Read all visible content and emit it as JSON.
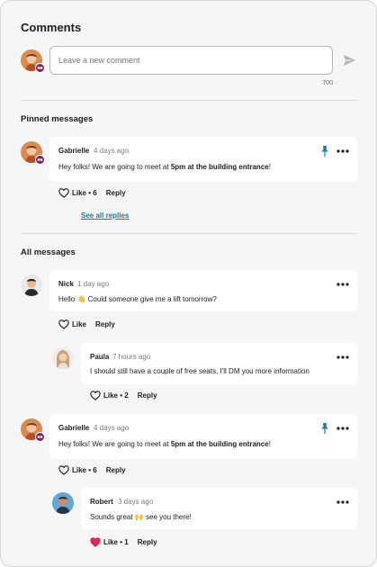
{
  "header": {
    "title": "Comments"
  },
  "composer": {
    "placeholder": "Leave a new comment",
    "counter": "700"
  },
  "sections": {
    "pinned": "Pinned messages",
    "all": "All messages"
  },
  "pinned_message": {
    "author": "Gabrielle",
    "time": "4 days ago",
    "text_before": "Hey folks! We are going to meet at ",
    "text_bold": "5pm at the building entrance",
    "text_after": "!",
    "like_label": "Like",
    "like_count": "• 6",
    "reply_label": "Reply",
    "see_replies": "See all replies"
  },
  "messages": [
    {
      "author": "Nick",
      "time": "1 day ago",
      "text_before": "Hello ",
      "emoji": "👋",
      "text_after": " Could someone give me a lift tomorrow?",
      "like_label": "Like",
      "reply_label": "Reply"
    },
    {
      "author": "Paula",
      "time": "7 hours ago",
      "text": "I should still have a couple of free seats, I'll DM you more information",
      "like_label": "Like",
      "like_count": "• 2",
      "reply_label": "Reply"
    },
    {
      "author": "Gabrielle",
      "time": "4 days ago",
      "text_before": "Hey folks! We are going to meet at ",
      "text_bold": "5pm at the building entrance",
      "text_after": "!",
      "like_label": "Like",
      "like_count": "• 6",
      "reply_label": "Reply"
    },
    {
      "author": "Robert",
      "time": "3 days ago",
      "text_before": "Sounds great ",
      "emoji": "🙌",
      "text_after": " see you there!",
      "like_label": "Like",
      "like_count": "• 1",
      "reply_label": "Reply",
      "liked": true
    }
  ],
  "icons": {
    "send": "send-icon",
    "pin": "pin-icon",
    "more": "more-options-icon",
    "heart": "heart-icon",
    "badge": "moderator-badge-icon"
  },
  "colors": {
    "accent": "#1f7a95",
    "pin": "#1f7a95",
    "badge": "#8e1a56",
    "liked_heart": "#e0245e"
  }
}
